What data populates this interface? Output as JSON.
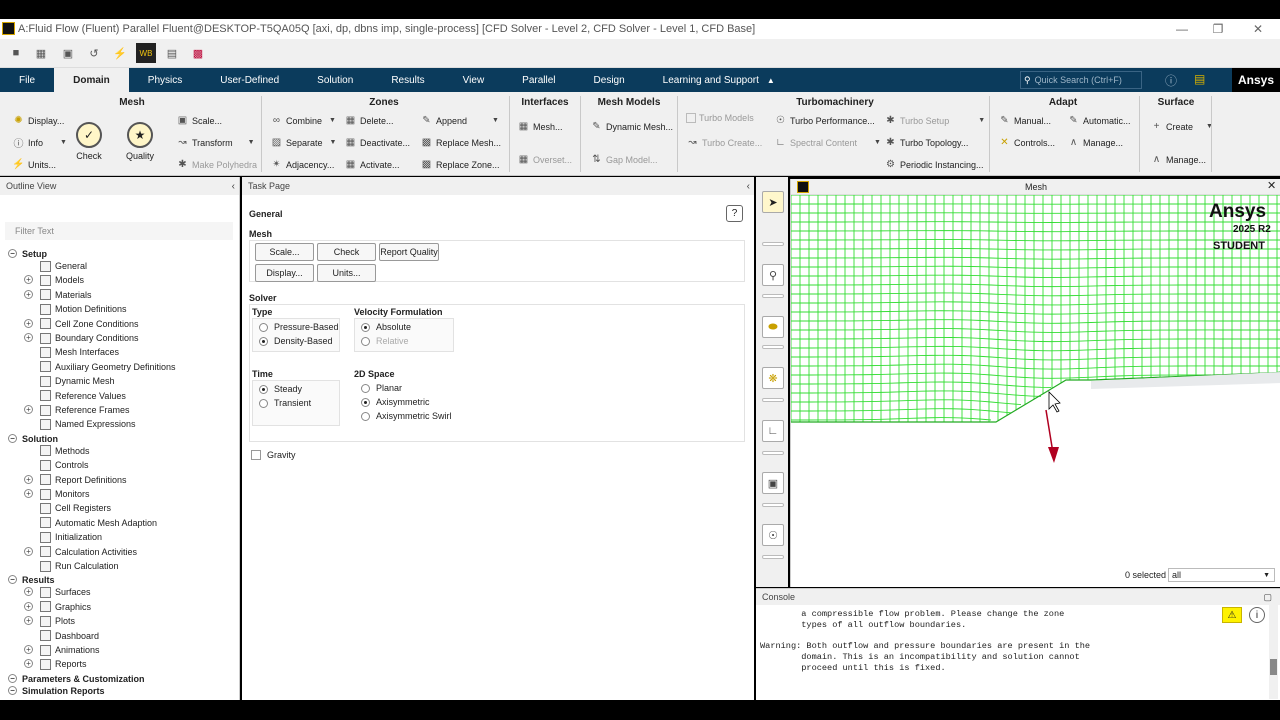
{
  "window": {
    "title": "A:Fluid Flow (Fluent) Parallel Fluent@DESKTOP-T5QA05Q  [axi, dp, dbns imp, single-process] [CFD Solver - Level 2, CFD Solver - Level 1, CFD Base]"
  },
  "menubar": {
    "tabs": [
      "File",
      "Domain",
      "Physics",
      "User-Defined",
      "Solution",
      "Results",
      "View",
      "Parallel",
      "Design",
      "Learning and Support"
    ],
    "active": "Domain",
    "quick_search_placeholder": "Quick Search (Ctrl+F)",
    "brand": "Ansys"
  },
  "ribbon": {
    "mesh": {
      "title": "Mesh",
      "display": "Display...",
      "info": "Info",
      "units": "Units...",
      "check": "Check",
      "quality": "Quality",
      "scale": "Scale...",
      "transform": "Transform",
      "make_polyhedra": "Make Polyhedra"
    },
    "zones": {
      "title": "Zones",
      "combine": "Combine",
      "separate": "Separate",
      "adjacency": "Adjacency...",
      "delete": "Delete...",
      "deactivate": "Deactivate...",
      "activate": "Activate...",
      "append": "Append",
      "replace_mesh": "Replace Mesh...",
      "replace_zone": "Replace Zone..."
    },
    "interfaces": {
      "title": "Interfaces",
      "mesh": "Mesh...",
      "overset": "Overset..."
    },
    "mesh_models": {
      "title": "Mesh Models",
      "dynamic_mesh": "Dynamic Mesh...",
      "gap_model": "Gap Model..."
    },
    "turbomachinery": {
      "title": "Turbomachinery",
      "turbo_models": "Turbo Models",
      "turbo_create": "Turbo Create...",
      "turbo_performance": "Turbo Performance...",
      "spectral_content": "Spectral Content",
      "turbo_setup": "Turbo Setup",
      "turbo_topology": "Turbo Topology...",
      "periodic_instancing": "Periodic Instancing..."
    },
    "adapt": {
      "title": "Adapt",
      "manual": "Manual...",
      "controls": "Controls...",
      "automatic": "Automatic...",
      "manage": "Manage..."
    },
    "surface": {
      "title": "Surface",
      "create": "Create",
      "manage": "Manage..."
    }
  },
  "outline": {
    "title": "Outline View",
    "filter_placeholder": "Filter Text",
    "setup": "Setup",
    "setup_items": [
      "General",
      "Models",
      "Materials",
      "Motion Definitions",
      "Cell Zone Conditions",
      "Boundary Conditions",
      "Mesh Interfaces",
      "Auxiliary Geometry Definitions",
      "Dynamic Mesh",
      "Reference Values",
      "Reference Frames",
      "Named Expressions"
    ],
    "solution": "Solution",
    "solution_items": [
      "Methods",
      "Controls",
      "Report Definitions",
      "Monitors",
      "Cell Registers",
      "Automatic Mesh Adaption",
      "Initialization",
      "Calculation Activities",
      "Run Calculation"
    ],
    "results": "Results",
    "results_items": [
      "Surfaces",
      "Graphics",
      "Plots",
      "Dashboard",
      "Animations",
      "Reports"
    ],
    "params": "Parameters & Customization",
    "sim_reports": "Simulation Reports"
  },
  "task": {
    "title": "Task Page",
    "heading": "General",
    "mesh_label": "Mesh",
    "btn_scale": "Scale...",
    "btn_check": "Check",
    "btn_report_quality": "Report Quality",
    "btn_display": "Display...",
    "btn_units": "Units...",
    "solver_label": "Solver",
    "type_label": "Type",
    "type_pressure": "Pressure-Based",
    "type_density": "Density-Based",
    "velocity_label": "Velocity Formulation",
    "vel_absolute": "Absolute",
    "vel_relative": "Relative",
    "time_label": "Time",
    "time_steady": "Steady",
    "time_transient": "Transient",
    "space_label": "2D Space",
    "space_planar": "Planar",
    "space_axi": "Axisymmetric",
    "space_axi_swirl": "Axisymmetric Swirl",
    "gravity": "Gravity"
  },
  "graphics": {
    "title": "Mesh",
    "brand": "Ansys",
    "version": "2025 R2",
    "edition": "STUDENT",
    "selected": "0 selected",
    "filter_value": "all",
    "mesh_color": "#33dd33"
  },
  "console": {
    "title": "Console",
    "lines": [
      "        a compressible flow problem. Please change the zone",
      "        types of all outflow boundaries.",
      "",
      "Warning: Both outflow and pressure boundaries are present in the",
      "        domain. This is an incompatibility and solution cannot",
      "        proceed until this is fixed."
    ]
  }
}
